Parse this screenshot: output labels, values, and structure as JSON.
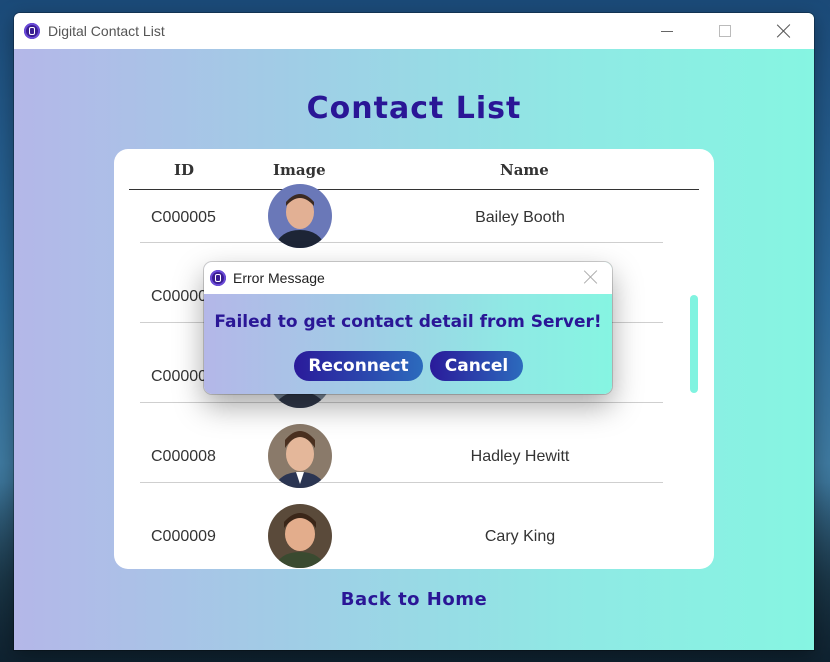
{
  "window": {
    "title": "Digital Contact List"
  },
  "heading": "Contact List",
  "table": {
    "columns": [
      "ID",
      "Image",
      "Name"
    ],
    "rows": [
      {
        "id": "C000005",
        "name": "Bailey Booth"
      },
      {
        "id": "C000006",
        "name": ""
      },
      {
        "id": "C000007",
        "name": ""
      },
      {
        "id": "C000008",
        "name": "Hadley Hewitt"
      },
      {
        "id": "C000009",
        "name": "Cary King"
      }
    ]
  },
  "back_link": "Back to Home",
  "dialog": {
    "title": "Error Message",
    "message": "Failed to get contact detail from Server!",
    "reconnect_label": "Reconnect",
    "cancel_label": "Cancel"
  },
  "colors": {
    "accent": "#2a1696",
    "gradient_start": "#b4b7e8",
    "gradient_end": "#86f5e2"
  }
}
